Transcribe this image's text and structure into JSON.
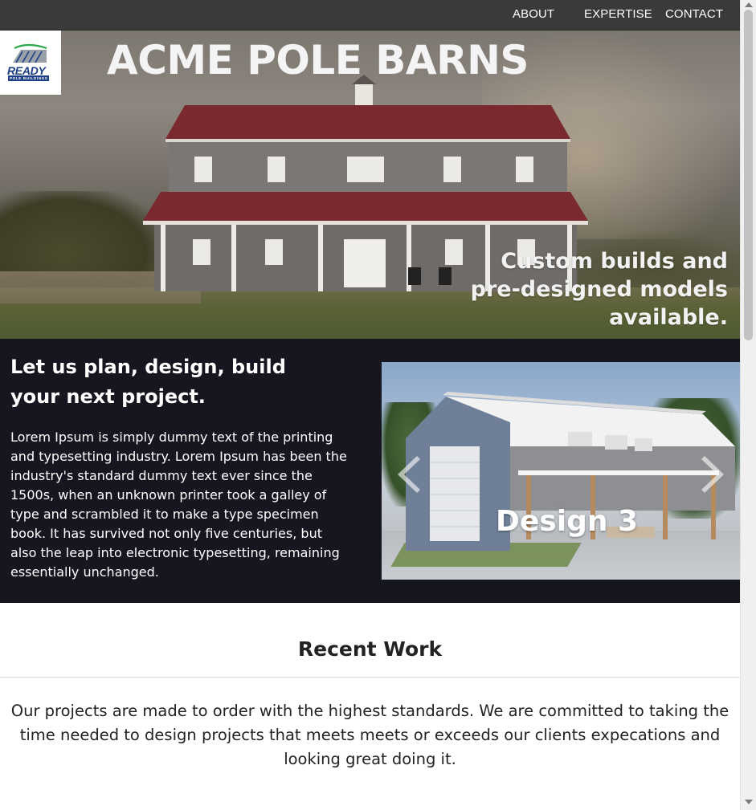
{
  "nav": {
    "about": "ABOUT",
    "expertise": "EXPERTISE",
    "contact": "CONTACT"
  },
  "hero": {
    "logo_text": "READY",
    "logo_sub": "POLE BUILDINGS",
    "title": "ACME POLE BARNS",
    "tagline": "Custom builds and pre-designed models available."
  },
  "intro": {
    "heading": "Let us plan, design, build your next project.",
    "body": "Lorem Ipsum is simply dummy text of the printing and typesetting industry. Lorem Ipsum has been the industry's standard dummy text ever since the 1500s, when an unknown printer took a galley of type and scrambled it to make a type specimen book. It has survived not only five centuries, but also the leap into electronic typesetting, remaining essentially unchanged."
  },
  "carousel": {
    "caption": "Design 3",
    "prev_icon": "chevron-left-icon",
    "next_icon": "chevron-right-icon"
  },
  "recent": {
    "title": "Recent Work",
    "description": "Our projects are made to order with the highest standards. We are committed to taking the time needed to design projects that meets meets or exceeds our clients expecations and looking great doing it."
  },
  "colors": {
    "nav_bg": "#3a3a3b",
    "intro_bg": "#161620",
    "barn_roof": "#7a2a2e",
    "barn_siding": "#7b7775"
  }
}
